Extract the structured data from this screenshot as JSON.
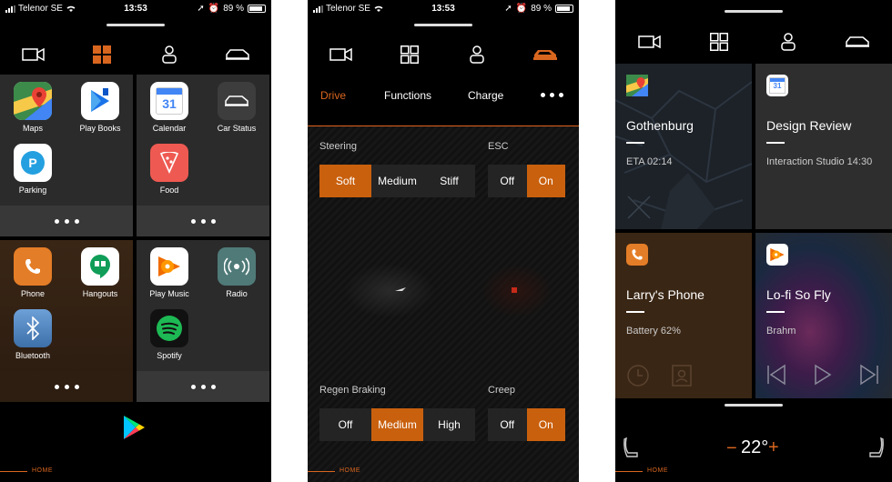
{
  "status_bar": {
    "carrier": "Telenor SE",
    "time": "13:53",
    "battery": "89 %"
  },
  "nav": {
    "items": [
      "video-camera",
      "apps-grid",
      "profile",
      "car"
    ]
  },
  "screen1": {
    "apps": [
      {
        "label": "Maps",
        "icon": "google-maps"
      },
      {
        "label": "Play Books",
        "icon": "play-books"
      },
      {
        "label": "Parking",
        "icon": "parking"
      },
      {
        "label": "Calendar",
        "icon": "calendar"
      },
      {
        "label": "Car Status",
        "icon": "car-status"
      },
      {
        "label": "Food",
        "icon": "food"
      },
      {
        "label": "Phone",
        "icon": "phone"
      },
      {
        "label": "Hangouts",
        "icon": "hangouts"
      },
      {
        "label": "Bluetooth",
        "icon": "bluetooth"
      },
      {
        "label": "Play Music",
        "icon": "play-music"
      },
      {
        "label": "Radio",
        "icon": "radio"
      },
      {
        "label": "Spotify",
        "icon": "spotify"
      }
    ],
    "calendar_day": "31",
    "home_label": "HOME"
  },
  "screen2": {
    "tabs": [
      "Drive",
      "Functions",
      "Charge"
    ],
    "active_tab": "Drive",
    "steering": {
      "label": "Steering",
      "options": [
        "Soft",
        "Medium",
        "Stiff"
      ],
      "selected": "Soft"
    },
    "esc": {
      "label": "ESC",
      "options": [
        "Off",
        "On"
      ],
      "selected": "On"
    },
    "regen": {
      "label": "Regen Braking",
      "options": [
        "Off",
        "Medium",
        "High"
      ],
      "selected": "Medium"
    },
    "creep": {
      "label": "Creep",
      "options": [
        "Off",
        "On"
      ],
      "selected": "On"
    },
    "home_label": "HOME"
  },
  "screen3": {
    "cards": [
      {
        "title": "Gothenburg",
        "subtitle": "ETA 02:14",
        "icon": "google-maps"
      },
      {
        "title": "Design Review",
        "subtitle": "Interaction Studio 14:30",
        "icon": "calendar"
      },
      {
        "title": "Larry's Phone",
        "subtitle": "Battery 62%",
        "icon": "phone"
      },
      {
        "title": "Lo-fi So Fly",
        "subtitle": "Brahm",
        "icon": "play-music"
      }
    ],
    "calendar_day": "31",
    "temperature": "22°",
    "home_label": "HOME"
  },
  "colors": {
    "accent": "#d9661f",
    "selected": "#c9600e",
    "tile": "#2b2b2b"
  }
}
